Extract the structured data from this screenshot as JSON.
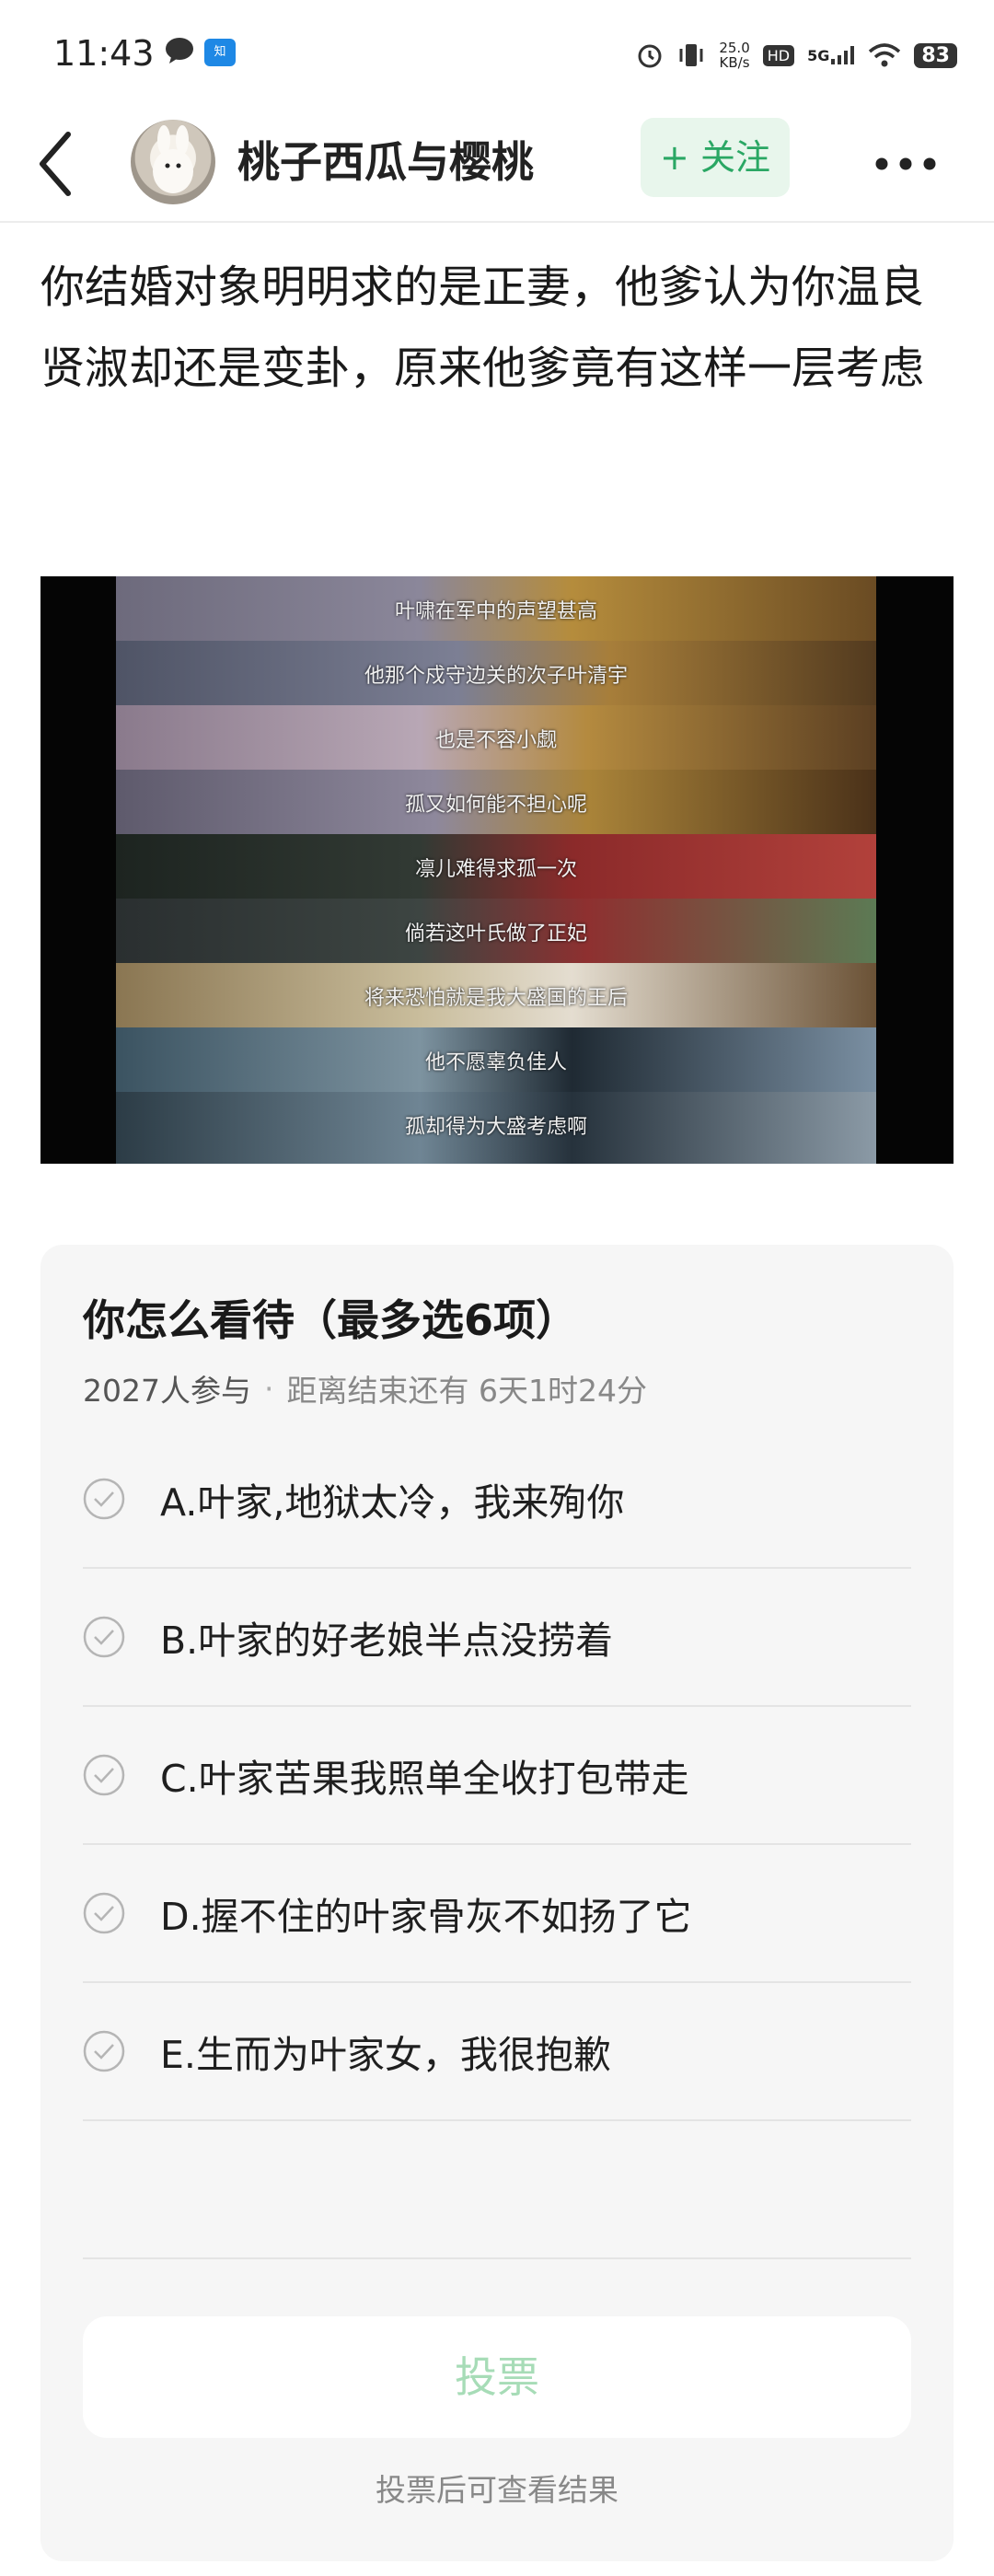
{
  "status_bar": {
    "time": "11:43",
    "network_speed": "25.0",
    "network_unit": "KB/s",
    "hd_label": "HD",
    "signal_label": "5G",
    "battery": "83",
    "icons": [
      "chat-bubble-icon",
      "zhihu-app-icon",
      "alarm-icon",
      "vibrate-icon",
      "signal-icon",
      "wifi-icon",
      "battery-icon"
    ]
  },
  "header": {
    "author_name": "桃子西瓜与樱桃",
    "follow_label": "+ 关注",
    "colors": {
      "follow_bg": "#e8f6ec",
      "follow_text": "#2aa764"
    }
  },
  "post": {
    "title": "你结婚对象明明求的是正妻，他爹认为你温良贤淑却还是变卦，原来他爹竟有这样一层考虑"
  },
  "media": {
    "captions": [
      "叶啸在军中的声望甚高",
      "他那个戍守边关的次子叶清宇",
      "也是不容小觑",
      "孤又如何能不担心呢",
      "凛儿难得求孤一次",
      "倘若这叶氏做了正妃",
      "将来恐怕就是我大盛国的王后",
      "他不愿辜负佳人",
      "孤却得为大盛考虑啊"
    ]
  },
  "poll": {
    "title": "你怎么看待（最多选6项）",
    "participants": "2027人参与",
    "separator": "·",
    "remaining": "距离结束还有 6天1时24分",
    "options": [
      "A.叶家,地狱太冷，我来殉你",
      "B.叶家的好老娘半点没捞着",
      "C.叶家苦果我照单全收打包带走",
      "D.握不住的叶家骨灰不如扬了它",
      "E.生而为叶家女，我很抱歉"
    ],
    "vote_label": "投票",
    "vote_hint": "投票后可查看结果",
    "colors": {
      "vote_text": "#a7dcb7",
      "card_bg": "#f6f6f6"
    }
  }
}
